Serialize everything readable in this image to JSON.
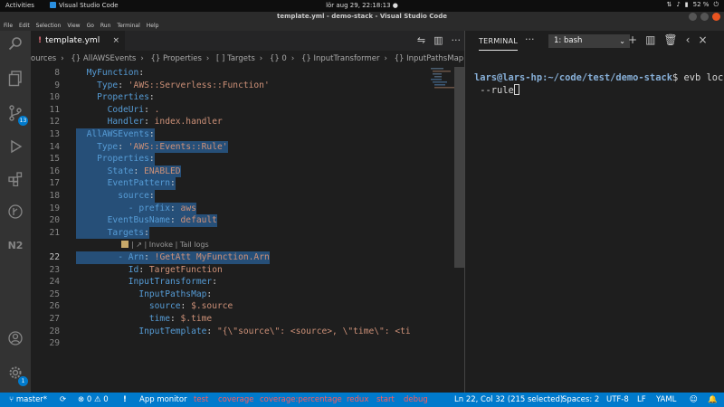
{
  "os": {
    "activities": "Activities",
    "app": "Visual Studio Code",
    "clock": "lör aug 29, 22:18:13 ●",
    "battery": "52 %"
  },
  "window": {
    "title": "template.yml - demo-stack - Visual Studio Code"
  },
  "menu": [
    "File",
    "Edit",
    "Selection",
    "View",
    "Go",
    "Run",
    "Terminal",
    "Help"
  ],
  "activity_bar": {
    "scm_badge": "13",
    "settings_badge": "1",
    "n2_label": "N2"
  },
  "editor": {
    "tab": {
      "label": "template.yml",
      "modified_marker": "!"
    },
    "breadcrumbs": [
      "ources",
      "{} AllAWSEvents",
      "{} Properties",
      "[ ] Targets",
      "{} 0",
      "{} InputTransformer",
      "{} InputPathsMap"
    ],
    "codelens": "| ↗ | Invoke | Tail logs",
    "lines": [
      {
        "n": "8",
        "indent": "  ",
        "key": "MyFunction",
        "sep": ":",
        "val": ""
      },
      {
        "n": "9",
        "indent": "    ",
        "key": "Type",
        "sep": ": ",
        "val": "'AWS::Serverless::Function'"
      },
      {
        "n": "10",
        "indent": "    ",
        "key": "Properties",
        "sep": ":",
        "val": ""
      },
      {
        "n": "11",
        "indent": "      ",
        "key": "CodeUri",
        "sep": ": ",
        "val": "."
      },
      {
        "n": "12",
        "indent": "      ",
        "key": "Handler",
        "sep": ": ",
        "val": "index.handler"
      },
      {
        "n": "13",
        "indent": "  ",
        "key": "AllAWSEvents",
        "sep": ":",
        "val": ""
      },
      {
        "n": "14",
        "indent": "    ",
        "key": "Type",
        "sep": ": ",
        "val": "'AWS::Events::Rule'"
      },
      {
        "n": "15",
        "indent": "    ",
        "key": "Properties",
        "sep": ":",
        "val": ""
      },
      {
        "n": "16",
        "indent": "      ",
        "key": "State",
        "sep": ": ",
        "val": "ENABLED"
      },
      {
        "n": "17",
        "indent": "      ",
        "key": "EventPattern",
        "sep": ":",
        "val": ""
      },
      {
        "n": "18",
        "indent": "        ",
        "key": "source",
        "sep": ":",
        "val": ""
      },
      {
        "n": "19",
        "indent": "          ",
        "key": "- prefix",
        "sep": ": ",
        "val": "aws"
      },
      {
        "n": "20",
        "indent": "      ",
        "key": "EventBusName",
        "sep": ": ",
        "val": "default"
      },
      {
        "n": "21",
        "indent": "      ",
        "key": "Targets",
        "sep": ":",
        "val": ""
      },
      {
        "n": "22",
        "indent": "        ",
        "key": "- Arn",
        "sep": ": ",
        "val": "!GetAtt MyFunction.Arn"
      },
      {
        "n": "23",
        "indent": "          ",
        "key": "Id",
        "sep": ": ",
        "val": "TargetFunction"
      },
      {
        "n": "24",
        "indent": "          ",
        "key": "InputTransformer",
        "sep": ":",
        "val": ""
      },
      {
        "n": "25",
        "indent": "            ",
        "key": "InputPathsMap",
        "sep": ":",
        "val": ""
      },
      {
        "n": "26",
        "indent": "              ",
        "key": "source",
        "sep": ": ",
        "val": "$.source"
      },
      {
        "n": "27",
        "indent": "              ",
        "key": "time",
        "sep": ": ",
        "val": "$.time"
      },
      {
        "n": "28",
        "indent": "            ",
        "key": "InputTemplate",
        "sep": ": ",
        "val": "\"{\\\"source\\\": <source>, \\\"time\\\": <ti"
      },
      {
        "n": "29",
        "indent": "",
        "key": "",
        "sep": "",
        "val": ""
      }
    ]
  },
  "terminal": {
    "tab_title": "TERMINAL",
    "selector": "1: bash",
    "prompt_user": "lars@lars-hp",
    "prompt_path": ":~/code/test/demo-stack",
    "prompt_symbol": "$",
    "command": " evb local",
    "command_cont": " --rule"
  },
  "status": {
    "branch": "master*",
    "errors": "0",
    "warnings": "0",
    "alert": "!",
    "app_monitor": "App monitor",
    "red_items": [
      "test",
      "coverage",
      "coverage:percentage",
      "redux",
      "start",
      "debug"
    ],
    "cursor_pos": "Ln 22, Col 32 (215 selected)",
    "spaces": "Spaces: 2",
    "encoding": "UTF-8",
    "eol": "LF",
    "language": "YAML"
  },
  "colors": {
    "accent": "#007acc",
    "selection": "#264f78",
    "yaml_key": "#569cd6",
    "yaml_string": "#ce9178"
  }
}
